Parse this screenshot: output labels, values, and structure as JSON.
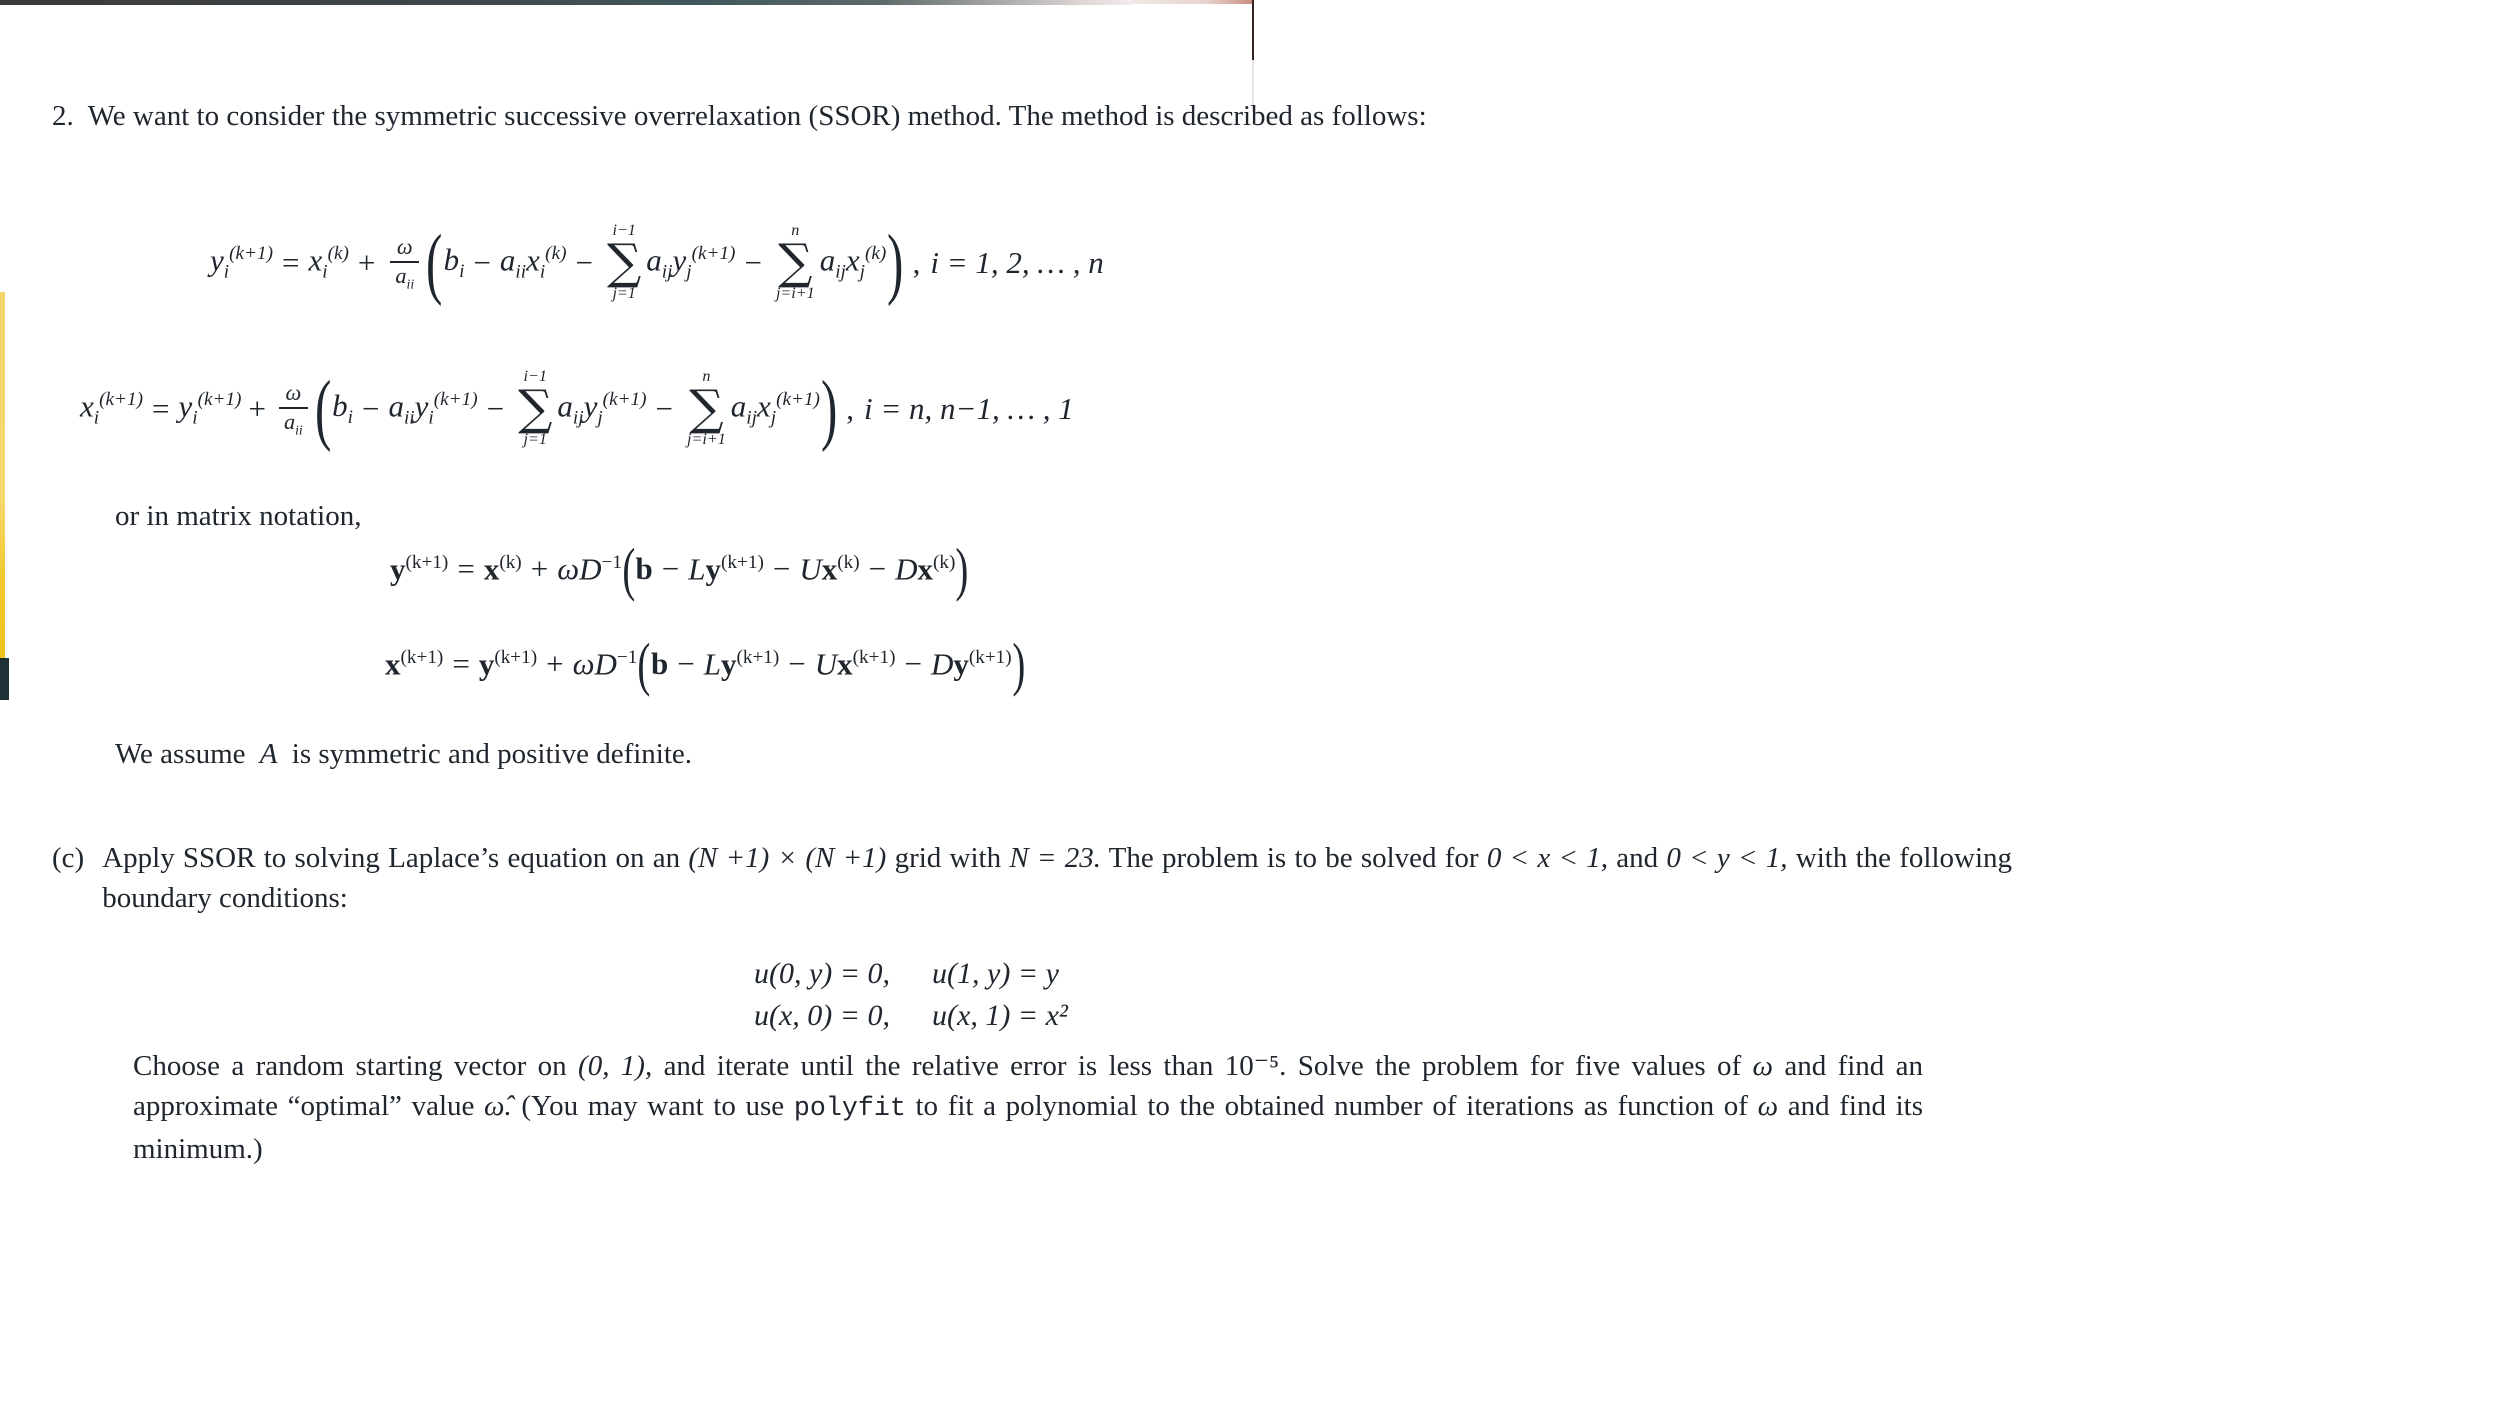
{
  "document": {
    "problem_number": "2.",
    "intro": "We want to consider the symmetric successive overrelaxation (SSOR) method. The method is described as follows:",
    "matrix_notation_lead": "or in matrix notation,",
    "assumption": "We assume A is symmetric and positive definite.",
    "assumption_parts": {
      "before": "We assume",
      "symbol": "A",
      "after": "is symmetric and positive definite."
    },
    "equations": {
      "eq1": {
        "id": "ssor-forward-sweep",
        "latex": "y_i^{(k+1)} = x_i^{(k)} + \\frac{\\omega}{a_{ii}}\\left(b_i - a_{ii}x_i^{(k)} - \\sum_{j=1}^{i-1} a_{ij}y_j^{(k+1)} - \\sum_{j=i+1}^{n} a_{ij}x_j^{(k)}\\right),\\ i = 1,2,\\ldots,n",
        "lhs_var": "y",
        "lhs_sub": "i",
        "lhs_sup": "(k+1)",
        "term1_var": "x",
        "term1_sub": "i",
        "term1_sup": "(k)",
        "frac_num": "ω",
        "frac_den_var": "a",
        "frac_den_sub": "ii",
        "b_var": "b",
        "b_sub": "i",
        "a_diag": "a",
        "a_diag_sub": "ii",
        "sum1_upper": "i−1",
        "sum1_lower": "j=1",
        "sum1_coef": "a",
        "sum1_coef_sub": "ij",
        "sum1_var": "y",
        "sum1_var_sub": "j",
        "sum1_var_sup": "(k+1)",
        "sum2_upper": "n",
        "sum2_lower": "j=i+1",
        "sum2_coef": "a",
        "sum2_coef_sub": "ij",
        "sum2_var": "x",
        "sum2_var_sub": "j",
        "sum2_var_sup": "(k)",
        "range": "i = 1, 2, … , n"
      },
      "eq2": {
        "id": "ssor-backward-sweep",
        "latex": "x_i^{(k+1)} = y_i^{(k+1)} + \\frac{\\omega}{a_{ii}}\\left(b_i - a_{ii}y_i^{(k+1)} - \\sum_{j=1}^{i-1} a_{ij}y_j^{(k+1)} - \\sum_{j=i+1}^{n} a_{ij}x_j^{(k+1)}\\right),\\ i = n, n-1,\\ldots,1",
        "lhs_var": "x",
        "lhs_sub": "i",
        "lhs_sup": "(k+1)",
        "term1_var": "y",
        "term1_sub": "i",
        "term1_sup": "(k+1)",
        "frac_num": "ω",
        "frac_den_var": "a",
        "frac_den_sub": "ii",
        "b_var": "b",
        "b_sub": "i",
        "a_diag": "a",
        "a_diag_sub": "ii",
        "a_diag_var": "y",
        "a_diag_var_sub": "i",
        "a_diag_var_sup": "(k+1)",
        "sum1_upper": "i−1",
        "sum1_lower": "j=1",
        "sum1_coef": "a",
        "sum1_coef_sub": "ij",
        "sum1_var": "y",
        "sum1_var_sub": "j",
        "sum1_var_sup": "(k+1)",
        "sum2_upper": "n",
        "sum2_lower": "j=i+1",
        "sum2_coef": "a",
        "sum2_coef_sub": "ij",
        "sum2_var": "x",
        "sum2_var_sub": "j",
        "sum2_var_sup": "(k+1)",
        "range": "i = n, n−1, … , 1"
      },
      "eq3": {
        "id": "matrix-forward-sweep",
        "latex": "\\mathbf{y}^{(k+1)} = \\mathbf{x}^{(k)} + \\omega D^{-1}\\left(\\mathbf{b} - L\\mathbf{y}^{(k+1)} - U\\mathbf{x}^{(k)} - D\\mathbf{x}^{(k)}\\right)",
        "lhs_var": "y",
        "lhs_sup": "(k+1)",
        "t1_var": "x",
        "t1_sup": "(k)",
        "omega": "ω",
        "dmat": "D",
        "dmat_sup": "−1",
        "b": "b",
        "l_mat": "L",
        "l_var": "y",
        "l_var_sup": "(k+1)",
        "u_mat": "U",
        "u_var": "x",
        "u_var_sup": "(k)",
        "d_mat": "D",
        "d_var": "x",
        "d_var_sup": "(k)"
      },
      "eq4": {
        "id": "matrix-backward-sweep",
        "latex": "\\mathbf{x}^{(k+1)} = \\mathbf{y}^{(k+1)} + \\omega D^{-1}\\left(\\mathbf{b} - L\\mathbf{y}^{(k+1)} - U\\mathbf{x}^{(k+1)} - D\\mathbf{y}^{(k+1)}\\right)",
        "lhs_var": "x",
        "lhs_sup": "(k+1)",
        "t1_var": "y",
        "t1_sup": "(k+1)",
        "omega": "ω",
        "dmat": "D",
        "dmat_sup": "−1",
        "b": "b",
        "l_mat": "L",
        "l_var": "y",
        "l_var_sup": "(k+1)",
        "u_mat": "U",
        "u_var": "x",
        "u_var_sup": "(k+1)",
        "d_mat": "D",
        "d_var": "y",
        "d_var_sup": "(k+1)"
      }
    },
    "part_c": {
      "marker": "(c)",
      "paragraph1_a": "Apply SSOR to solving Laplace’s equation on an",
      "paragraph1_grid": "(N +1) × (N +1)",
      "paragraph1_b": "grid with",
      "paragraph1_n": "N = 23.",
      "paragraph1_c": "The problem is to be solved for",
      "paragraph1_xrange": "0 < x < 1,",
      "paragraph1_d": "and",
      "paragraph1_yrange": "0 < y < 1,",
      "paragraph1_e": "with the following boundary conditions:",
      "boundary_conditions": [
        {
          "left": "u(0, y) = 0,",
          "right": "u(1, y) = y"
        },
        {
          "left": "u(x, 0) = 0,",
          "right": "u(x, 1) = x²"
        }
      ],
      "paragraph2_a": "Choose a random starting vector on",
      "paragraph2_interval": "(0, 1),",
      "paragraph2_b": "and iterate until the relative error is less than",
      "paragraph2_tol": "10⁻⁵.",
      "paragraph2_c": "Solve the problem for five values of",
      "paragraph2_omega": "ω",
      "paragraph2_d": "and find an approximate “optimal” value",
      "paragraph2_omegahat": "ω̂.",
      "paragraph2_e": "(You may want to use",
      "paragraph2_code": "polyfit",
      "paragraph2_f": "to fit a polynomial to the obtained number of iterations as function of",
      "paragraph2_omega2": "ω",
      "paragraph2_g": "and find its minimum.)"
    }
  },
  "colors": {
    "text": "#20262e",
    "accent_yellow": "#f2c92f",
    "accent_dark": "#1e3138",
    "page_background": "#ffffff"
  }
}
